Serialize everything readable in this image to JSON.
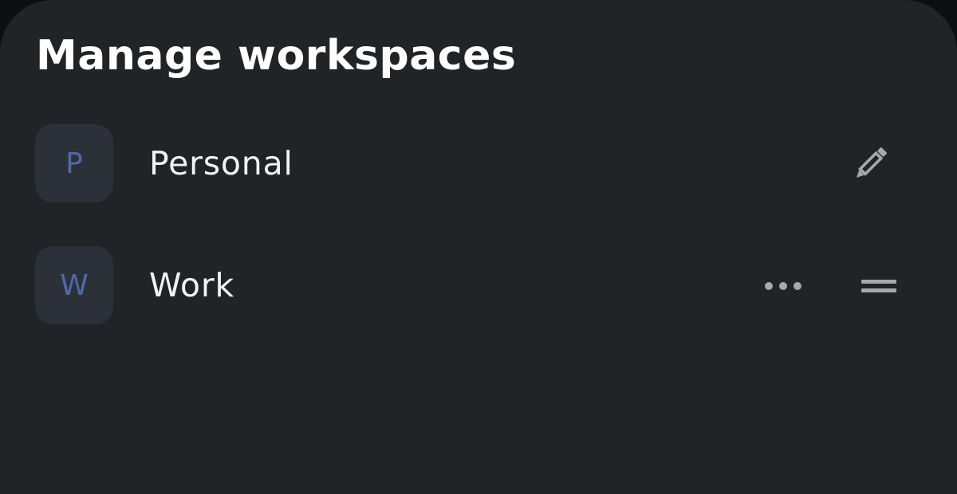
{
  "sheet": {
    "title": "Manage workspaces"
  },
  "workspaces": [
    {
      "initial": "P",
      "name": "Personal",
      "action_icon": "pencil-icon"
    },
    {
      "initial": "W",
      "name": "Work",
      "action_icon": "more-horizontal-icon",
      "secondary_icon": "drag-handle-icon"
    }
  ],
  "colors": {
    "background": "#212326",
    "avatar_background": "#2b3039",
    "avatar_letter": "#4f6aa8",
    "text": "#f1f2f3",
    "icon": "#a6a8ab"
  }
}
